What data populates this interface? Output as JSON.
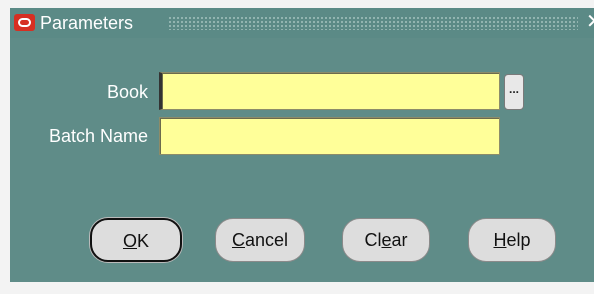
{
  "window": {
    "title": "Parameters"
  },
  "form": {
    "book_label": "Book",
    "book_value": "",
    "batch_label": "Batch Name",
    "batch_value": "",
    "lov_button_label": "..."
  },
  "buttons": {
    "ok": {
      "mnemonic": "O",
      "rest": "K"
    },
    "cancel": {
      "mnemonic": "C",
      "rest": "ancel"
    },
    "clear": {
      "pre": "Cl",
      "mnemonic": "e",
      "rest": "ar"
    },
    "help": {
      "mnemonic": "H",
      "rest": "elp"
    }
  },
  "colors": {
    "panel": "#5f8c88",
    "titlebar": "#5b8a86",
    "field": "#ffff99",
    "button": "#dddddd"
  },
  "icons": {
    "logo": "oracle-logo-icon",
    "close": "close-icon",
    "lov": "ellipsis-icon"
  }
}
